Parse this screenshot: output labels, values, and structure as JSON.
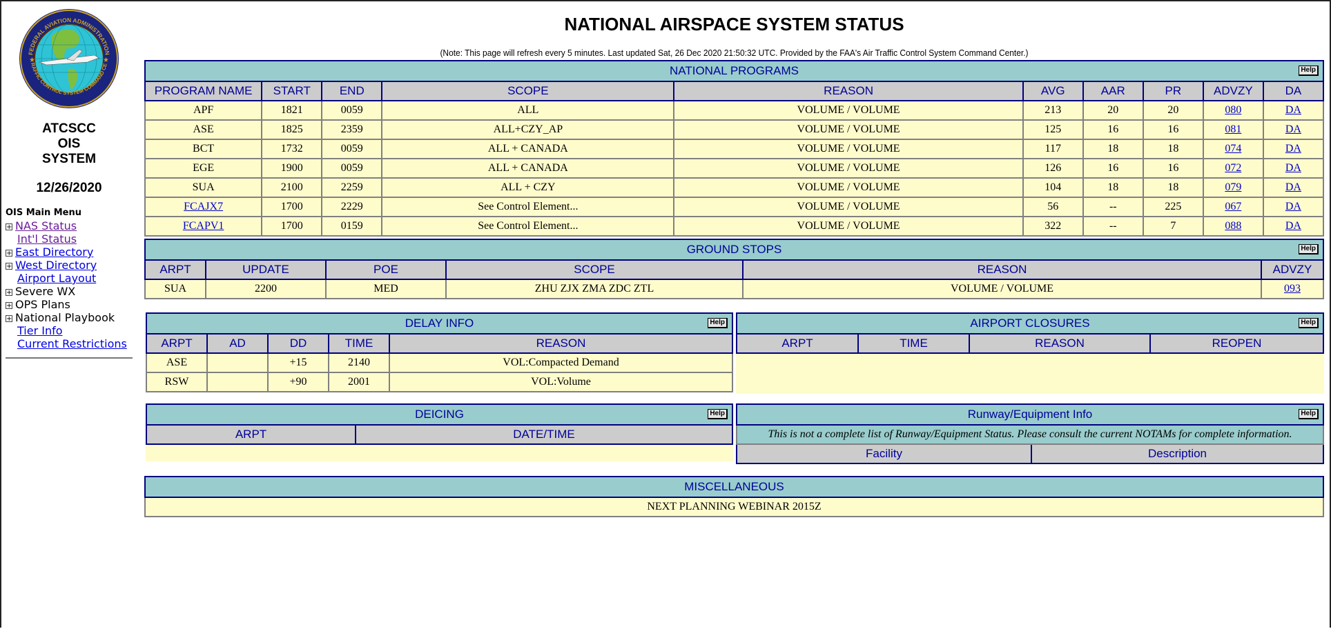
{
  "sidebar": {
    "logo_label": "Federal Aviation Administration - Air Traffic Control System Command Center seal",
    "name_lines": [
      "ATCSCC",
      "OIS",
      "SYSTEM"
    ],
    "date": "12/26/2020",
    "menu_title": "OIS Main Menu",
    "menu": [
      {
        "label": "NAS Status",
        "expand": true,
        "link": true,
        "visited": true
      },
      {
        "label": "Int'l Status",
        "expand": false,
        "link": true,
        "visited": true
      },
      {
        "label": "East Directory",
        "expand": true,
        "link": true,
        "visited": false
      },
      {
        "label": "West Directory",
        "expand": true,
        "link": true,
        "visited": false
      },
      {
        "label": "Airport Layout",
        "expand": false,
        "link": true,
        "visited": false
      },
      {
        "label": "Severe WX",
        "expand": true,
        "link": false
      },
      {
        "label": "OPS Plans",
        "expand": true,
        "link": false
      },
      {
        "label": "National Playbook",
        "expand": true,
        "link": false
      },
      {
        "label": "Tier Info",
        "expand": false,
        "link": true,
        "visited": false
      },
      {
        "label": "Current Restrictions",
        "expand": false,
        "link": true,
        "visited": false
      }
    ]
  },
  "header": {
    "title": "NATIONAL AIRSPACE SYSTEM STATUS",
    "note": "(Note: This page will refresh every 5 minutes.  Last updated Sat, 26 Dec 2020 21:50:32 UTC.  Provided by the FAA's Air Traffic Control System Command Center.)"
  },
  "help_label": "Help",
  "national_programs": {
    "title": "NATIONAL PROGRAMS",
    "columns": [
      "PROGRAM NAME",
      "START",
      "END",
      "SCOPE",
      "REASON",
      "AVG",
      "AAR",
      "PR",
      "ADVZY",
      "DA"
    ],
    "rows": [
      {
        "name": "APF",
        "name_link": false,
        "start": "1821",
        "end": "0059",
        "scope": "ALL",
        "reason": "VOLUME / VOLUME",
        "avg": "213",
        "aar": "20",
        "pr": "20",
        "advzy": "080",
        "da": "DA"
      },
      {
        "name": "ASE",
        "name_link": false,
        "start": "1825",
        "end": "2359",
        "scope": "ALL+CZY_AP",
        "reason": "VOLUME / VOLUME",
        "avg": "125",
        "aar": "16",
        "pr": "16",
        "advzy": "081",
        "da": "DA"
      },
      {
        "name": "BCT",
        "name_link": false,
        "start": "1732",
        "end": "0059",
        "scope": "ALL + CANADA",
        "reason": "VOLUME / VOLUME",
        "avg": "117",
        "aar": "18",
        "pr": "18",
        "advzy": "074",
        "da": "DA"
      },
      {
        "name": "EGE",
        "name_link": false,
        "start": "1900",
        "end": "0059",
        "scope": "ALL + CANADA",
        "reason": "VOLUME / VOLUME",
        "avg": "126",
        "aar": "16",
        "pr": "16",
        "advzy": "072",
        "da": "DA"
      },
      {
        "name": "SUA",
        "name_link": false,
        "start": "2100",
        "end": "2259",
        "scope": "ALL + CZY",
        "reason": "VOLUME / VOLUME",
        "avg": "104",
        "aar": "18",
        "pr": "18",
        "advzy": "079",
        "da": "DA"
      },
      {
        "name": "FCAJX7",
        "name_link": true,
        "start": "1700",
        "end": "2229",
        "scope": "See Control Element...",
        "reason": "VOLUME / VOLUME",
        "avg": "56",
        "aar": "--",
        "pr": "225",
        "advzy": "067",
        "da": "DA"
      },
      {
        "name": "FCAPV1",
        "name_link": true,
        "start": "1700",
        "end": "0159",
        "scope": "See Control Element...",
        "reason": "VOLUME / VOLUME",
        "avg": "322",
        "aar": "--",
        "pr": "7",
        "advzy": "088",
        "da": "DA"
      }
    ]
  },
  "ground_stops": {
    "title": "GROUND STOPS",
    "columns": [
      "ARPT",
      "UPDATE",
      "POE",
      "SCOPE",
      "REASON",
      "ADVZY"
    ],
    "rows": [
      {
        "arpt": "SUA",
        "update": "2200",
        "poe": "MED",
        "scope": "ZHU ZJX ZMA ZDC ZTL",
        "reason": "VOLUME / VOLUME",
        "advzy": "093"
      }
    ]
  },
  "delay_info": {
    "title": "DELAY INFO",
    "columns": [
      "ARPT",
      "AD",
      "DD",
      "TIME",
      "REASON"
    ],
    "rows": [
      {
        "arpt": "ASE",
        "ad": "",
        "dd": "+15",
        "time": "2140",
        "reason": "VOL:Compacted Demand"
      },
      {
        "arpt": "RSW",
        "ad": "",
        "dd": "+90",
        "time": "2001",
        "reason": "VOL:Volume"
      }
    ]
  },
  "airport_closures": {
    "title": "AIRPORT CLOSURES",
    "columns": [
      "ARPT",
      "TIME",
      "REASON",
      "REOPEN"
    ],
    "rows": []
  },
  "deicing": {
    "title": "DEICING",
    "columns": [
      "ARPT",
      "DATE/TIME"
    ],
    "rows": []
  },
  "runway_equipment": {
    "title": "Runway/Equipment Info",
    "notice": "This is not a complete list of Runway/Equipment Status. Please consult the current NOTAMs for complete information.",
    "columns": [
      "Facility",
      "Description"
    ],
    "rows": []
  },
  "miscellaneous": {
    "title": "MISCELLANEOUS",
    "text": "NEXT PLANNING WEBINAR 2015Z"
  }
}
